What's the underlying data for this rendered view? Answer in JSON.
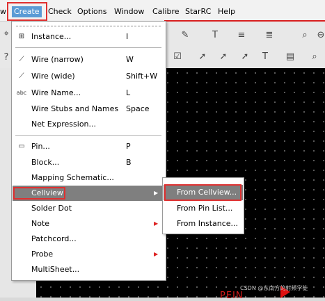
{
  "menubar": {
    "items": [
      {
        "label": "w"
      },
      {
        "label": "Create"
      },
      {
        "label": "Check"
      },
      {
        "label": "Options"
      },
      {
        "label": "Window"
      },
      {
        "label": "Calibre"
      },
      {
        "label": "StarRC"
      },
      {
        "label": "Help"
      }
    ]
  },
  "create_menu": {
    "items": [
      {
        "label": "Instance...",
        "shortcut": "I",
        "icon": "instance-icon"
      },
      {
        "label": "Wire (narrow)",
        "shortcut": "W",
        "icon": "wire-narrow-icon"
      },
      {
        "label": "Wire (wide)",
        "shortcut": "Shift+W",
        "icon": "wire-wide-icon"
      },
      {
        "label": "Wire Name...",
        "shortcut": "L",
        "icon": "wire-name-icon"
      },
      {
        "label": "Wire Stubs and Names",
        "shortcut": "Space",
        "icon": ""
      },
      {
        "label": "Net Expression...",
        "shortcut": "",
        "icon": ""
      },
      {
        "label": "Pin...",
        "shortcut": "P",
        "icon": "pin-icon"
      },
      {
        "label": "Block...",
        "shortcut": "B",
        "icon": ""
      },
      {
        "label": "Mapping Schematic...",
        "shortcut": "",
        "icon": ""
      },
      {
        "label": "Cellview",
        "shortcut": "",
        "icon": "",
        "submenu": true
      },
      {
        "label": "Solder Dot",
        "shortcut": "",
        "icon": ""
      },
      {
        "label": "Note",
        "shortcut": "",
        "icon": "",
        "submenu": true
      },
      {
        "label": "Patchcord...",
        "shortcut": "",
        "icon": ""
      },
      {
        "label": "Probe",
        "shortcut": "",
        "icon": "",
        "submenu": true
      },
      {
        "label": "MultiSheet...",
        "shortcut": "",
        "icon": ""
      }
    ]
  },
  "cellview_submenu": {
    "items": [
      {
        "label": "From Cellview..."
      },
      {
        "label": "From Pin List..."
      },
      {
        "label": "From Instance..."
      }
    ]
  },
  "canvas": {
    "pin_label": "PEIN",
    "watermark": "CSDN @东南方的射频学徒"
  },
  "colors": {
    "highlight": "#7f7f7f",
    "annotation_red": "#e03030",
    "canvas": "#000000"
  }
}
